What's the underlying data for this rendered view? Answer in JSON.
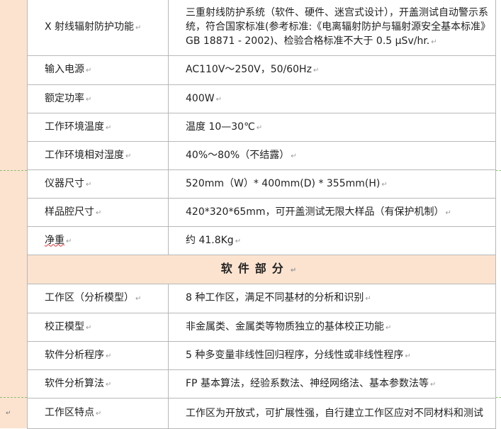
{
  "hardware_rows": [
    {
      "label": "X 射线辐射防护功能",
      "value": "三重射线防护系统（软件、硬件、迷宫式设计），开盖测试自动警示系统，符合国家标准(参考标准:《电离辐射防护与辐射源安全基本标准》GB 18871 - 2002)、检验合格标准不大于 0.5  μSv/hr."
    },
    {
      "label": "输入电源",
      "value": "AC110V～250V，50/60Hz"
    },
    {
      "label": "额定功率",
      "value": "400W"
    },
    {
      "label": "工作环境温度",
      "value": "温度 10—30℃"
    },
    {
      "label": "工作环境相对湿度",
      "value": "40%～80%（不结露）"
    },
    {
      "label": "仪器尺寸",
      "value": "520mm（W）* 400mm(D) * 355mm(H)"
    },
    {
      "label": "样品腔尺寸",
      "value": "420*320*65mm，可开盖测试无限大样品（有保护机制）"
    },
    {
      "label": "净重",
      "value": "约 41.8Kg"
    }
  ],
  "section_title": "软件部分",
  "software_rows": [
    {
      "label": "工作区（分析模型）",
      "value": "8 种工作区，满足不同基材的分析和识别"
    },
    {
      "label": "校正模型",
      "value": "非金属类、金属类等物质独立的基体校正功能"
    },
    {
      "label": "软件分析程序",
      "value": "5 种多变量非线性回归程序，分线性或非线性程序"
    },
    {
      "label": "软件分析算法",
      "value": "FP 基本算法，经验系数法、神经网络法、基本参数法等"
    },
    {
      "label": "工作区特点",
      "value": "工作区为开放式，可扩展性强，自行建立工作区应对不同材料和测试"
    }
  ],
  "paragraph_mark": "↵",
  "return_mark": "↵"
}
